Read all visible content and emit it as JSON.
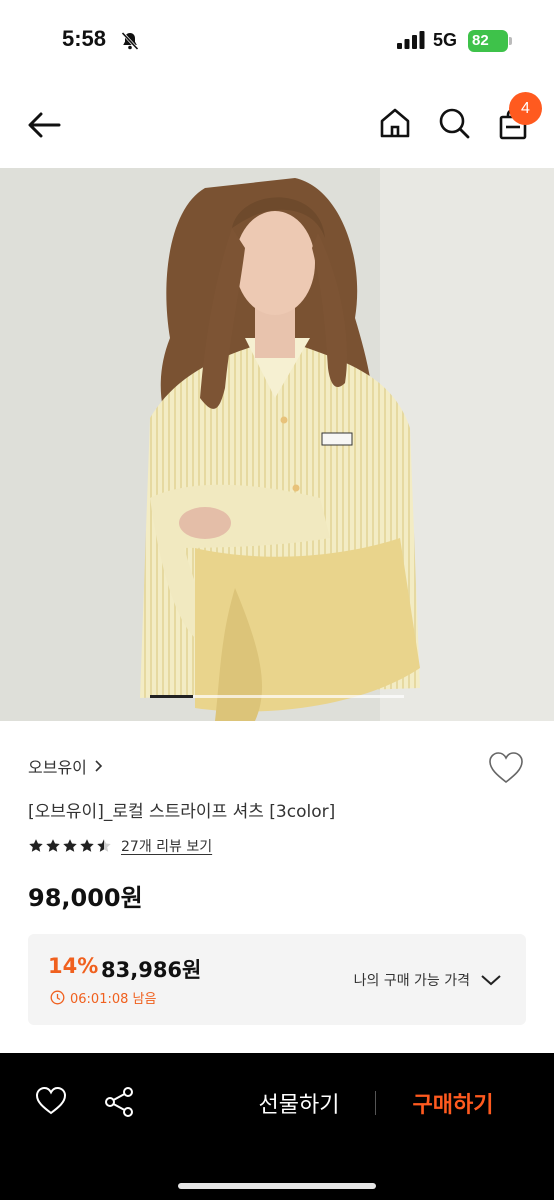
{
  "status_bar": {
    "time": "5:58",
    "network": "5G",
    "battery": "82"
  },
  "nav": {
    "cart_count": "4",
    "icons": [
      "back-arrow-icon",
      "home-icon",
      "search-icon",
      "shopping-bag-icon"
    ]
  },
  "product": {
    "image_index_fraction": 0.17,
    "brand": "오브유이",
    "title": "[오브유이]_로컬 스트라이프 셔츠 [3color]",
    "rating_stars": 4.5,
    "review_link": "27개 리뷰 보기",
    "original_price": "98,000원",
    "discount": {
      "rate": "14%",
      "price": "83,986원",
      "timer": "06:01:08 남음",
      "my_price_label": "나의 구매 가능 가격"
    }
  },
  "bottom_bar": {
    "gift_label": "선물하기",
    "buy_label": "구매하기"
  },
  "colors": {
    "accent": "#ff5a1f",
    "discount_text": "#f0601e",
    "battery": "#3ec24a",
    "bottom_bar_bg": "#000000"
  }
}
